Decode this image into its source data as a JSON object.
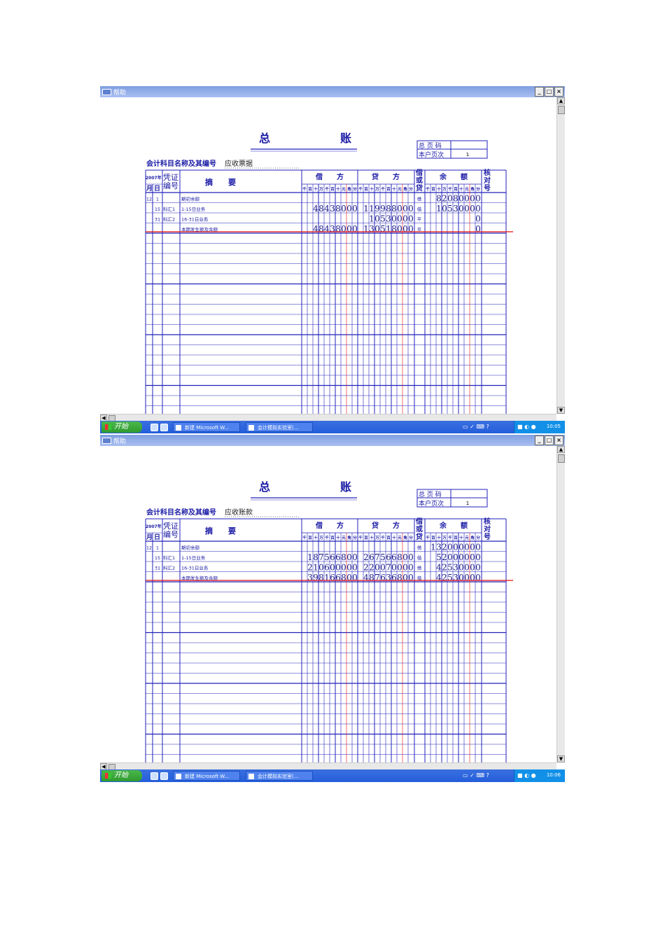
{
  "window_title": "帮助",
  "window_buttons": [
    "_",
    "□",
    "×"
  ],
  "ledger_title": "总账",
  "page_box": {
    "total_page_label": "总 页 码",
    "account_page_label": "本户页次",
    "account_page_value": "1"
  },
  "account_label": "会计科目名称及其编号",
  "header": {
    "year": "2007年",
    "month": "月",
    "day": "日",
    "voucher": "凭证编号",
    "summary": "摘　　要",
    "debit": "借　　方",
    "credit": "贷　　方",
    "dc": "借或贷",
    "balance": "余　　额",
    "check": "核对号",
    "digit_units": [
      "千",
      "百",
      "十",
      "万",
      "千",
      "百",
      "十",
      "元",
      "角",
      "分"
    ]
  },
  "ledgers": [
    {
      "account_name": "应收票据",
      "rows": [
        {
          "month": "12",
          "day": "1",
          "voucher": "",
          "summary": "期初余额",
          "debit": "",
          "credit": "",
          "dc": "借",
          "balance": "82080000"
        },
        {
          "month": "",
          "day": "15",
          "voucher": "科汇1",
          "summary": "1-15日业务",
          "debit": "48438000",
          "credit": "119988000",
          "dc": "借",
          "balance": "10530000"
        },
        {
          "month": "",
          "day": "31",
          "voucher": "科汇2",
          "summary": "16-31日业务",
          "debit": "",
          "credit": "10530000",
          "dc": "平",
          "balance": "0"
        },
        {
          "month": "",
          "day": "",
          "voucher": "",
          "summary": "本期发生额及余额",
          "debit": "48438000",
          "credit": "130518000",
          "dc": "平",
          "balance": "0"
        }
      ]
    },
    {
      "account_name": "应收账款",
      "rows": [
        {
          "month": "12",
          "day": "1",
          "voucher": "",
          "summary": "期初余额",
          "debit": "",
          "credit": "",
          "dc": "借",
          "balance": "132000000"
        },
        {
          "month": "",
          "day": "15",
          "voucher": "科汇1",
          "summary": "1-15日业务",
          "debit": "187566800",
          "credit": "267566800",
          "dc": "借",
          "balance": "52000000"
        },
        {
          "month": "",
          "day": "31",
          "voucher": "科汇2",
          "summary": "16-31日业务",
          "debit": "210600000",
          "credit": "220070000",
          "dc": "借",
          "balance": "42530000"
        },
        {
          "month": "",
          "day": "",
          "voucher": "",
          "summary": "本期发生额及余额",
          "debit": "398166800",
          "credit": "487636800",
          "dc": "借",
          "balance": "42530000"
        }
      ]
    }
  ],
  "taskbar": {
    "start_label": "开始",
    "tasks": [
      "新建 Microsoft W...",
      "会计模拟实验室(..."
    ],
    "clocks": [
      "10:05",
      "10:06"
    ]
  },
  "colors": {
    "ink": "#1a1aa6",
    "rule": "#2222bb",
    "red_rule": "#e01010",
    "titlebar": "#8fa9e8",
    "taskbar": "#2d63d8"
  }
}
